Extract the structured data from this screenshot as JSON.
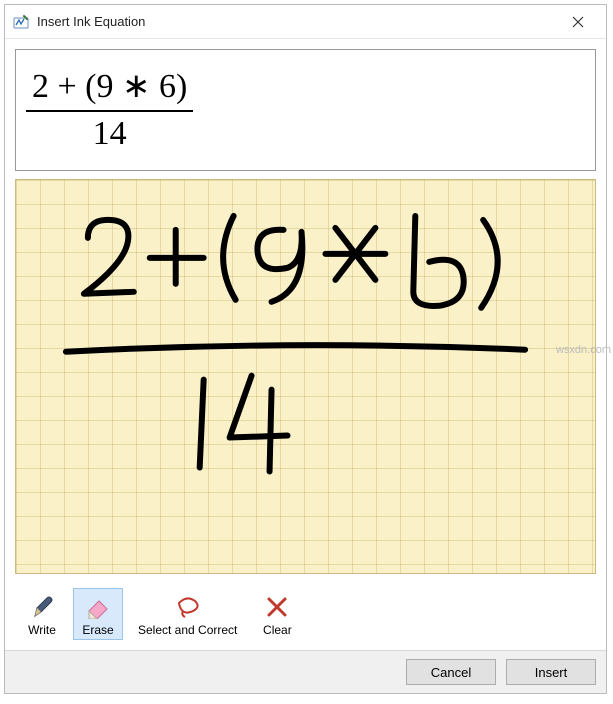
{
  "window": {
    "title": "Insert Ink Equation"
  },
  "equation": {
    "recognized_text": "(2 + (9 * 6)) / 14",
    "numerator": "2 + (9 ∗ 6)",
    "denominator": "14"
  },
  "toolbar": {
    "write": "Write",
    "erase": "Erase",
    "select_correct": "Select and Correct",
    "clear": "Clear",
    "active": "erase"
  },
  "footer": {
    "cancel": "Cancel",
    "insert": "Insert"
  },
  "canvas": {
    "ink_color": "#000000",
    "background_color": "#faf1c8"
  },
  "watermark": "wsxdn.com"
}
